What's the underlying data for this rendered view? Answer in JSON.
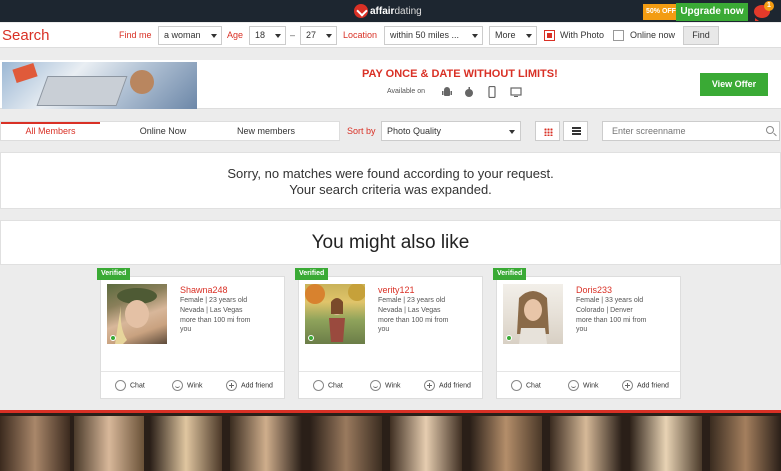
{
  "header": {
    "logo_bold": "affair",
    "logo_light": "dating",
    "discount_badge": "50% OFF",
    "upgrade_label": "Upgrade now",
    "notification_count": "1"
  },
  "search": {
    "title": "Search",
    "find_me_label": "Find me",
    "find_me_value": "a woman",
    "age_label": "Age",
    "age_from": "18",
    "age_separator": "–",
    "age_to": "27",
    "location_label": "Location",
    "location_value": "within 50 miles ...",
    "more_value": "More",
    "with_photo_label": "With Photo",
    "with_photo_checked": true,
    "online_now_label": "Online now",
    "online_now_checked": false,
    "find_button": "Find"
  },
  "banner": {
    "headline": "PAY ONCE & DATE WITHOUT LIMITS!",
    "available_on": "Available on",
    "platforms": [
      "android-icon",
      "apple-icon",
      "phone-icon",
      "tv-icon"
    ],
    "cta": "View Offer"
  },
  "filters": {
    "tabs": [
      {
        "label": "All Members",
        "active": true
      },
      {
        "label": "Online Now",
        "active": false
      },
      {
        "label": "New members",
        "active": false
      }
    ],
    "sort_label": "Sort by",
    "sort_value": "Photo Quality",
    "screenname_placeholder": "Enter screenname"
  },
  "messages": {
    "no_match_line1": "Sorry, no matches were found according to your request.",
    "no_match_line2": "Your search criteria was expanded.",
    "might_like": "You might also like"
  },
  "cards": [
    {
      "badge": "Verified",
      "name": "Shawna248",
      "gender_age": "Female | 23 years old",
      "location": "Nevada | Las Vegas",
      "distance": "more than 100 mi from you",
      "actions": {
        "chat": "Chat",
        "wink": "Wink",
        "add": "Add friend"
      }
    },
    {
      "badge": "Verified",
      "name": "verity121",
      "gender_age": "Female | 23 years old",
      "location": "Nevada | Las Vegas",
      "distance": "more than 100 mi from you",
      "actions": {
        "chat": "Chat",
        "wink": "Wink",
        "add": "Add friend"
      }
    },
    {
      "badge": "Verified",
      "name": "Doris233",
      "gender_age": "Female | 33 years old",
      "location": "Colorado | Denver",
      "distance": "more than 100 mi from you",
      "actions": {
        "chat": "Chat",
        "wink": "Wink",
        "add": "Add friend"
      }
    }
  ],
  "colors": {
    "accent_red": "#d93025",
    "green": "#3aaa35",
    "topbar": "#1d2630",
    "orange": "#f39c12"
  }
}
